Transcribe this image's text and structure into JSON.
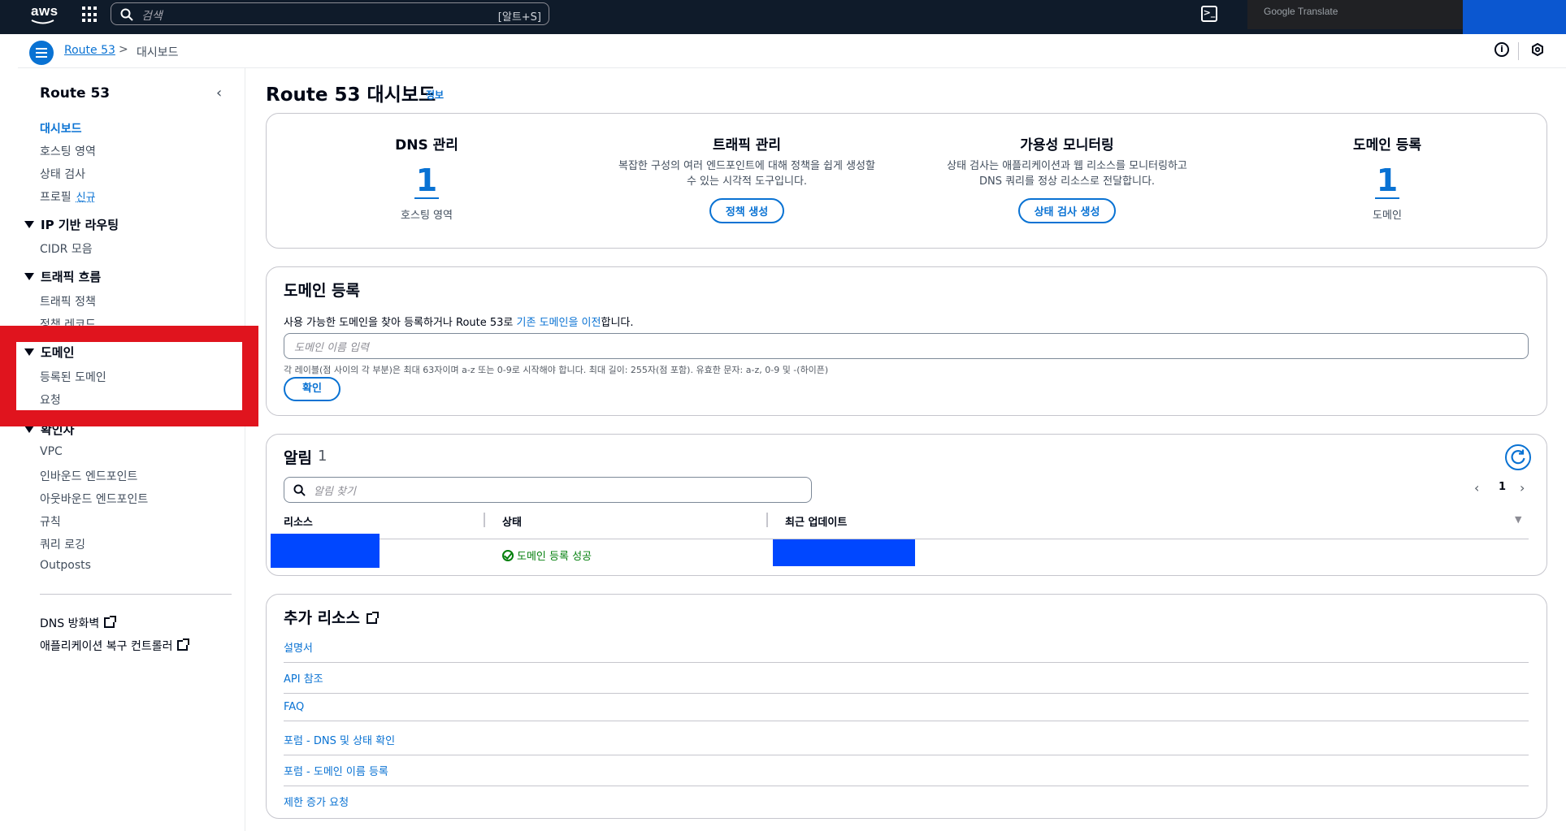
{
  "topnav": {
    "logo": "aws",
    "search_placeholder": "검색",
    "search_shortcut": "[알트+S]",
    "translate_label": "Google Translate"
  },
  "breadcrumb": {
    "link": "Route 53",
    "separator": ">",
    "current": "대시보드"
  },
  "sidebar": {
    "title": "Route 53",
    "top_items": [
      {
        "label": "대시보드",
        "active": true
      },
      {
        "label": "호스팅 영역"
      },
      {
        "label": "상태 검사"
      },
      {
        "label": "프로필",
        "badge": "신규"
      }
    ],
    "sections": [
      {
        "label": "IP 기반 라우팅",
        "items": [
          "CIDR 모음"
        ]
      },
      {
        "label": "트래픽 흐름",
        "items": [
          "트래픽 정책",
          "정책 레코드"
        ]
      },
      {
        "label": "도메인",
        "items": [
          "등록된 도메인",
          "요청"
        ]
      },
      {
        "label": "확인자",
        "items": [
          "VPC",
          "인바운드 엔드포인트",
          "아웃바운드 엔드포인트",
          "규칙",
          "쿼리 로깅",
          "Outposts"
        ]
      }
    ],
    "external_links": [
      "DNS 방화벽",
      "애플리케이션 복구 컨트롤러"
    ]
  },
  "page": {
    "title": "Route 53 대시보드",
    "info": "정보"
  },
  "summary": [
    {
      "heading": "DNS 관리",
      "value": "1",
      "sub": "호스팅 영역"
    },
    {
      "heading": "트래픽 관리",
      "desc1": "복잡한 구성의 여러 엔드포인트에 대해 정책을 쉽게 생성할",
      "desc2": "수 있는 시각적 도구입니다.",
      "button": "정책 생성"
    },
    {
      "heading": "가용성 모니터링",
      "desc1": "상태 검사는 애플리케이션과 웹 리소스를 모니터링하고",
      "desc2": "DNS 쿼리를 정상 리소스로 전달합니다.",
      "button": "상태 검사 생성"
    },
    {
      "heading": "도메인 등록",
      "value": "1",
      "sub": "도메인"
    }
  ],
  "domain_register": {
    "title": "도메인 등록",
    "desc_prefix": "사용 가능한 도메인을 찾아 등록하거나 Route 53로 ",
    "desc_link": "기존 도메인을 이전",
    "desc_suffix": "합니다.",
    "input_placeholder": "도메인 이름 입력",
    "hint": "각 레이블(점 사이의 각 부분)은 최대 63자이며 a-z 또는 0-9로 시작해야 합니다. 최대 길이: 255자(점 포함). 유효한 문자: a-z, 0-9 및 -(하이픈)",
    "confirm": "확인"
  },
  "alerts": {
    "title": "알림",
    "count": "1",
    "search_placeholder": "알림 찾기",
    "page": "1",
    "columns": [
      "리소스",
      "상태",
      "최근 업데이트"
    ],
    "rows": [
      {
        "status": "도메인 등록 성공"
      }
    ]
  },
  "resources": {
    "title": "추가 리소스",
    "links": [
      "설명서",
      "API 참조",
      "FAQ",
      "포럼 - DNS 및 상태 확인",
      "포럼 - 도메인 이름 등록",
      "제한 증가 요청"
    ]
  }
}
